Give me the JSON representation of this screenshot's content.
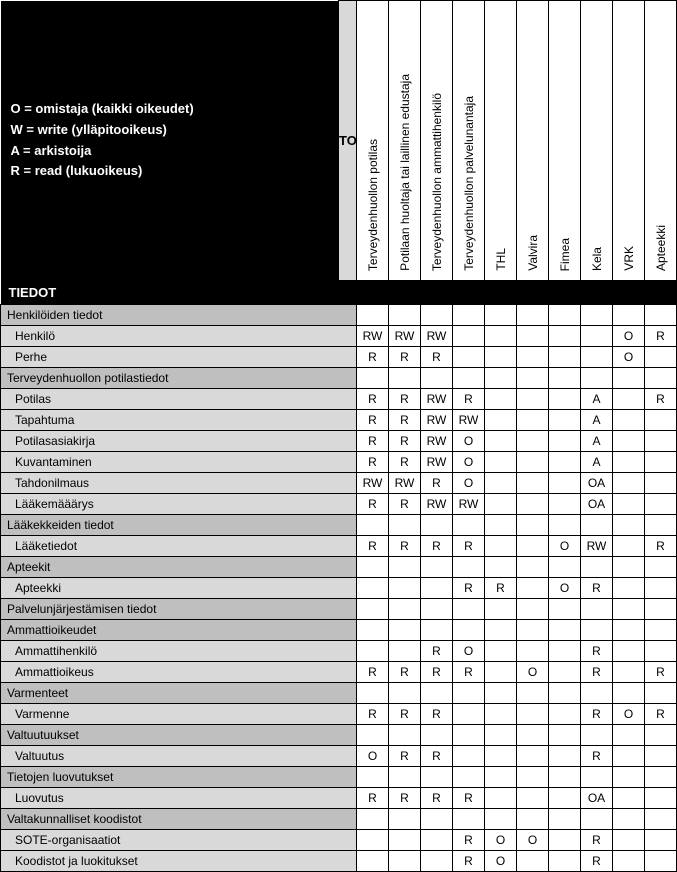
{
  "legend": {
    "o": "O = omistaja (kaikki oikeudet)",
    "w": "W = write (ylläpitooikeus)",
    "a": "A = arkistoija",
    "r": "R = read (lukuoikeus)"
  },
  "header": {
    "toimijat": "TOIMIJAT",
    "tiedot": "TIEDOT"
  },
  "actors": [
    "Terveydenhuollon potilas",
    "Potilaan huoltaja tai laillinen edustaja",
    "Terveydenhuollon ammattihenkilö",
    "Terveydenhuollon palvelunantaja",
    "THL",
    "Valvira",
    "Fimea",
    "Kela",
    "VRK",
    "Apteekki"
  ],
  "rows": [
    {
      "type": "section",
      "label": "Henkilöiden tiedot"
    },
    {
      "type": "data",
      "label": "Henkilö",
      "cells": [
        "RW",
        "RW",
        "RW",
        "",
        "",
        "",
        "",
        "",
        "O",
        "R"
      ]
    },
    {
      "type": "data",
      "label": "Perhe",
      "cells": [
        "R",
        "R",
        "R",
        "",
        "",
        "",
        "",
        "",
        "O",
        ""
      ]
    },
    {
      "type": "section",
      "label": "Terveydenhuollon potilastiedot"
    },
    {
      "type": "data",
      "label": "Potilas",
      "cells": [
        "R",
        "R",
        "RW",
        "R",
        "",
        "",
        "",
        "A",
        "",
        "R"
      ]
    },
    {
      "type": "data",
      "label": "Tapahtuma",
      "cells": [
        "R",
        "R",
        "RW",
        "RW",
        "",
        "",
        "",
        "A",
        "",
        ""
      ]
    },
    {
      "type": "data",
      "label": "Potilasasiakirja",
      "cells": [
        "R",
        "R",
        "RW",
        "O",
        "",
        "",
        "",
        "A",
        "",
        ""
      ]
    },
    {
      "type": "data",
      "label": "Kuvantaminen",
      "cells": [
        "R",
        "R",
        "RW",
        "O",
        "",
        "",
        "",
        "A",
        "",
        ""
      ]
    },
    {
      "type": "data",
      "label": "Tahdonilmaus",
      "cells": [
        "RW",
        "RW",
        "R",
        "O",
        "",
        "",
        "",
        "OA",
        "",
        ""
      ]
    },
    {
      "type": "data",
      "label": "Lääkemääärys",
      "cells": [
        "R",
        "R",
        "RW",
        "RW",
        "",
        "",
        "",
        "OA",
        "",
        ""
      ]
    },
    {
      "type": "section",
      "label": "Lääkekkeiden tiedot"
    },
    {
      "type": "data",
      "label": "Lääketiedot",
      "cells": [
        "R",
        "R",
        "R",
        "R",
        "",
        "",
        "O",
        "RW",
        "",
        "R"
      ]
    },
    {
      "type": "section",
      "label": "Apteekit"
    },
    {
      "type": "data",
      "label": "Apteekki",
      "cells": [
        "",
        "",
        "",
        "R",
        "R",
        "",
        "O",
        "R",
        "",
        ""
      ]
    },
    {
      "type": "section",
      "label": "Palvelunjärjestämisen tiedot"
    },
    {
      "type": "section",
      "label": "Ammattioikeudet"
    },
    {
      "type": "data",
      "label": "Ammattihenkilö",
      "cells": [
        "",
        "",
        "R",
        "O",
        "",
        "",
        "",
        "R",
        "",
        ""
      ]
    },
    {
      "type": "data",
      "label": "Ammattioikeus",
      "cells": [
        "R",
        "R",
        "R",
        "R",
        "",
        "O",
        "",
        "R",
        "",
        "R"
      ]
    },
    {
      "type": "section",
      "label": "Varmenteet"
    },
    {
      "type": "data",
      "label": "Varmenne",
      "cells": [
        "R",
        "R",
        "R",
        "",
        "",
        "",
        "",
        "R",
        "O",
        "R"
      ]
    },
    {
      "type": "section",
      "label": "Valtuutuukset"
    },
    {
      "type": "data",
      "label": "Valtuutus",
      "cells": [
        "O",
        "R",
        "R",
        "",
        "",
        "",
        "",
        "R",
        "",
        ""
      ]
    },
    {
      "type": "section",
      "label": "Tietojen luovutukset"
    },
    {
      "type": "data",
      "label": "Luovutus",
      "cells": [
        "R",
        "R",
        "R",
        "R",
        "",
        "",
        "",
        "OA",
        "",
        ""
      ]
    },
    {
      "type": "section",
      "label": "Valtakunnalliset koodistot"
    },
    {
      "type": "data",
      "label": "SOTE-organisaatiot",
      "cells": [
        "",
        "",
        "",
        "R",
        "O",
        "O",
        "",
        "R",
        "",
        ""
      ]
    },
    {
      "type": "data",
      "label": "Koodistot ja luokitukset",
      "cells": [
        "",
        "",
        "",
        "R",
        "O",
        "",
        "",
        "R",
        "",
        ""
      ]
    }
  ]
}
